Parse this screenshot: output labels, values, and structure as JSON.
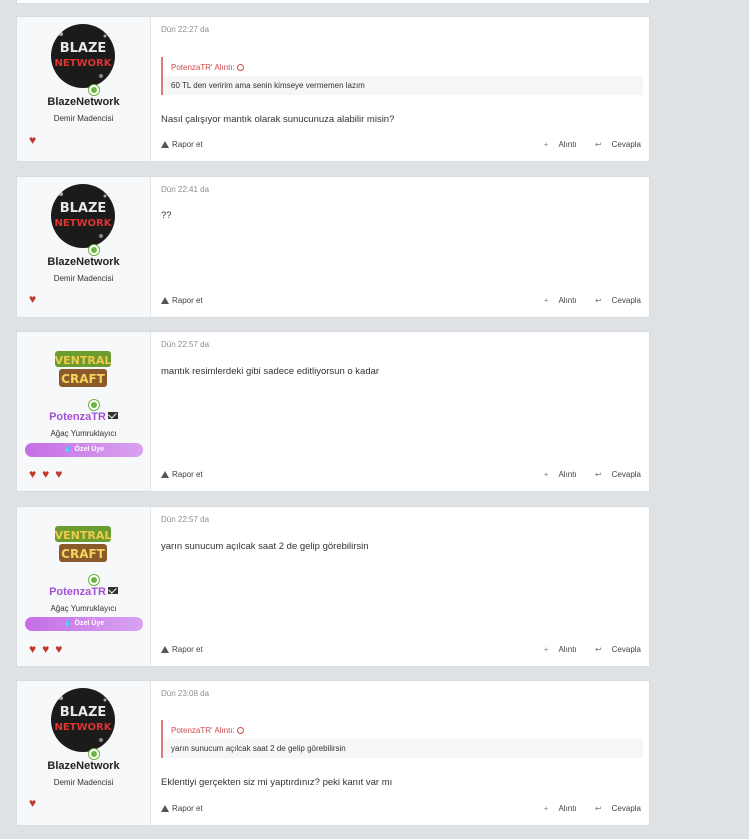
{
  "posts": [
    {
      "user": {
        "name": "BlazeNetwork",
        "title": "Demir Madencisi",
        "avatar": "blaze-network-logo",
        "hearts": 1,
        "badge": null
      },
      "date": "Dün 22:27 da",
      "quote": {
        "header": "PotenzaTR' Alıntı:",
        "text": "60 TL den veririm ama senin kimseye vermemen lazım"
      },
      "message": "Nasıl çalışıyor mantık olarak sunucunuza alabilir misin?",
      "actions": {
        "report": "Rapor et",
        "quote": "Alıntı",
        "reply": "Cevapla"
      }
    },
    {
      "user": {
        "name": "BlazeNetwork",
        "title": "Demir Madencisi",
        "avatar": "blaze-network-logo",
        "hearts": 1,
        "badge": null
      },
      "date": "Dün 22:41 da",
      "quote": null,
      "message": "??",
      "actions": {
        "report": "Rapor et",
        "quote": "Alıntı",
        "reply": "Cevapla"
      }
    },
    {
      "user": {
        "name": "PotenzaTR",
        "title": "Ağaç Yumruklayıcı",
        "avatar": "ventral-craft-logo",
        "hearts": 3,
        "badge": "Özel Üye"
      },
      "date": "Dün 22:57 da",
      "quote": null,
      "message": "mantık resimlerdeki gibi sadece editliyorsun o kadar",
      "actions": {
        "report": "Rapor et",
        "quote": "Alıntı",
        "reply": "Cevapla"
      }
    },
    {
      "user": {
        "name": "PotenzaTR",
        "title": "Ağaç Yumruklayıcı",
        "avatar": "ventral-craft-logo",
        "hearts": 3,
        "badge": "Özel Üye"
      },
      "date": "Dün 22:57 da",
      "quote": null,
      "message": "yarın sunucum açılcak saat 2 de gelip görebilirsin",
      "actions": {
        "report": "Rapor et",
        "quote": "Alıntı",
        "reply": "Cevapla"
      }
    },
    {
      "user": {
        "name": "BlazeNetwork",
        "title": "Demir Madencisi",
        "avatar": "blaze-network-logo",
        "hearts": 1,
        "badge": null
      },
      "date": "Dün 23:08 da",
      "quote": {
        "header": "PotenzaTR' Alıntı:",
        "text": "yarın sunucum açılcak saat 2 de gelip görebilirsin"
      },
      "message": "Eklentiyi gerçekten siz mi yaptırdınız? peki kanıt var mı",
      "actions": {
        "report": "Rapor et",
        "quote": "Alıntı",
        "reply": "Cevapla"
      }
    }
  ],
  "colors": {
    "heart": "#c0392b",
    "quote_accent": "#d04b4b",
    "vip_name": "#a551d6",
    "online": "#6cb33f"
  }
}
